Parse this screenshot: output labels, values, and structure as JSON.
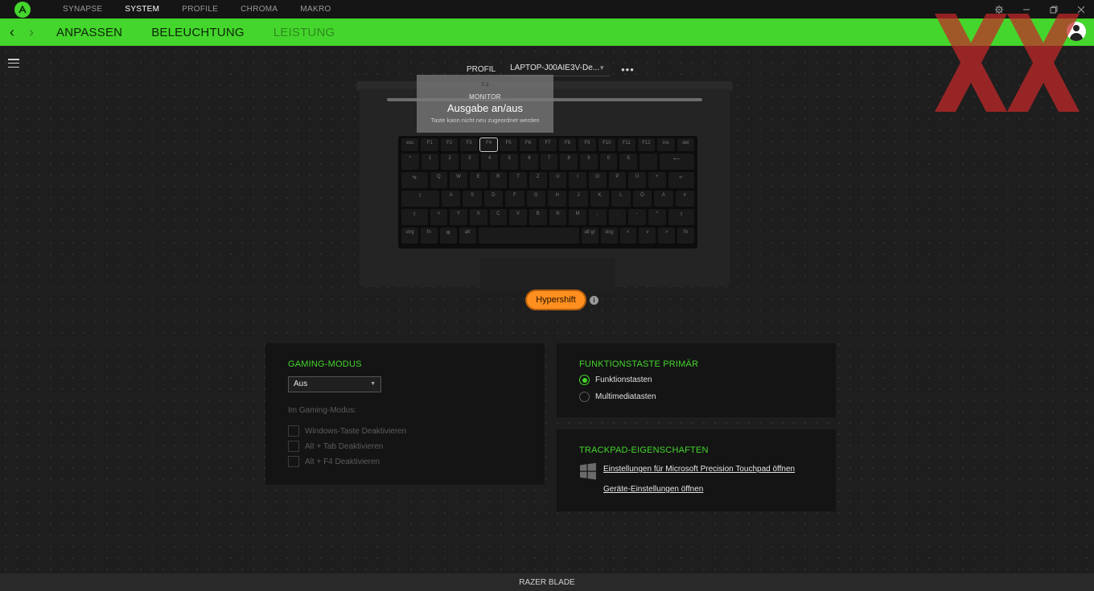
{
  "nav": {
    "tabs": [
      {
        "label": "SYNAPSE"
      },
      {
        "label": "SYSTEM"
      },
      {
        "label": "PROFILE"
      },
      {
        "label": "CHROMA"
      },
      {
        "label": "MAKRO"
      }
    ],
    "active": "SYSTEM"
  },
  "subnav": {
    "tabs": [
      {
        "label": "ANPASSEN"
      },
      {
        "label": "BELEUCHTUNG"
      },
      {
        "label": "LEISTUNG"
      }
    ]
  },
  "profile": {
    "label": "PROFIL",
    "value": "LAPTOP-J00AIE3V-De..."
  },
  "tooltip": {
    "key": "F4",
    "category": "MONITOR",
    "title": "Ausgabe an/aus",
    "note": "Taste kann nicht neu zugeordnet werden"
  },
  "hypershift": {
    "label": "Hypershift"
  },
  "gaming": {
    "title": "GAMING-MODUS",
    "value": "Aus",
    "sub_label": "Im Gaming-Modus:",
    "options": [
      {
        "label": "Windows-Taste Deaktivieren"
      },
      {
        "label": "Alt + Tab Deaktivieren"
      },
      {
        "label": "Alt + F4 Deaktivieren"
      }
    ]
  },
  "fn_primary": {
    "title": "FUNKTIONSTASTE PRIMÄR",
    "options": [
      {
        "label": "Funktionstasten",
        "selected": true
      },
      {
        "label": "Multimediatasten",
        "selected": false
      }
    ]
  },
  "trackpad": {
    "title": "TRACKPAD-EIGENSCHAFTEN",
    "link1": "Einstellungen für Microsoft Precision Touchpad öffnen",
    "link2": "Geräte-Einstellungen öffnen"
  },
  "footer": {
    "device": "RAZER BLADE"
  },
  "keyboard": {
    "rows": [
      [
        "esc",
        "F1",
        "F2",
        "F3",
        "F4",
        "F5",
        "F6",
        "F7",
        "F8",
        "F9",
        "F10",
        "F11",
        "F12",
        "ins",
        "del"
      ],
      [
        "^",
        "1",
        "2",
        "3",
        "4",
        "5",
        "6",
        "7",
        "8",
        "9",
        "0",
        "ß",
        "´",
        "⟵"
      ],
      [
        "⇆",
        "Q",
        "W",
        "E",
        "R",
        "T",
        "Z",
        "U",
        "I",
        "O",
        "P",
        "Ü",
        "+",
        "↵"
      ],
      [
        "⇪",
        "A",
        "S",
        "D",
        "F",
        "G",
        "H",
        "J",
        "K",
        "L",
        "Ö",
        "Ä",
        "#"
      ],
      [
        "⇧",
        "<",
        "Y",
        "X",
        "C",
        "V",
        "B",
        "N",
        "M",
        ",",
        ".",
        "-",
        "^",
        "⇧"
      ],
      [
        "strg",
        "fn",
        "⊞",
        "alt",
        "",
        "alt gr",
        "strg",
        "<",
        "v",
        ">",
        "fn"
      ]
    ]
  },
  "colors": {
    "accent": "#44d62c",
    "hypershift": "#ff8f1f"
  }
}
